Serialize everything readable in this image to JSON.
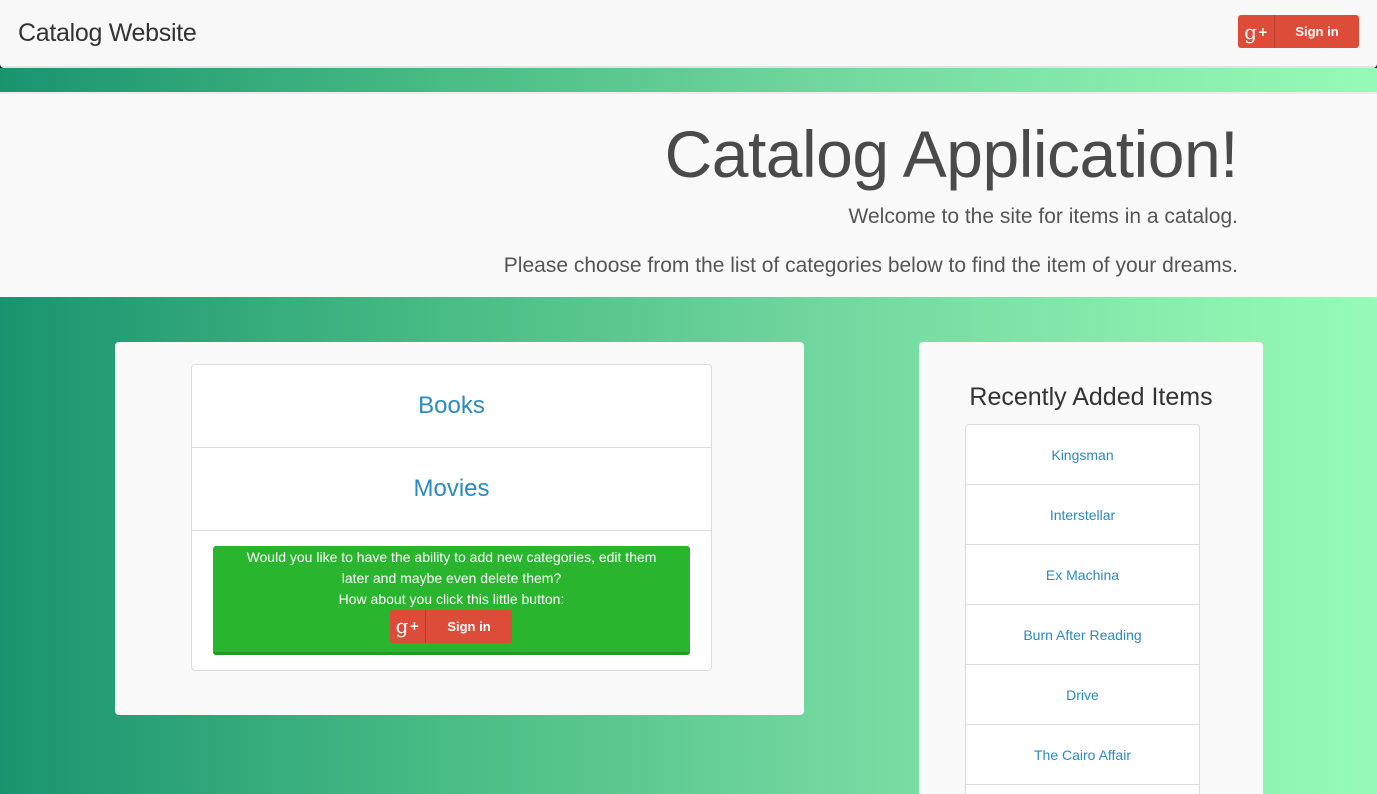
{
  "navbar": {
    "brand": "Catalog Website",
    "signin_label": "Sign in"
  },
  "jumbotron": {
    "title": "Catalog Application!",
    "lead1": "Welcome to the site for items in a catalog.",
    "lead2": "Please choose from the list of categories below to find the item of your dreams."
  },
  "categories": [
    {
      "label": "Books"
    },
    {
      "label": "Movies"
    }
  ],
  "promo": {
    "line1": "Would you like to have the ability to add new categories, edit them",
    "line2": "later and maybe even delete them?",
    "line3": "How about you click this little button:",
    "signin_label": "Sign in"
  },
  "recent": {
    "title": "Recently Added Items",
    "items": [
      {
        "label": "Kingsman"
      },
      {
        "label": "Interstellar"
      },
      {
        "label": "Ex Machina"
      },
      {
        "label": "Burn After Reading"
      },
      {
        "label": "Drive"
      },
      {
        "label": "The Cairo Affair"
      }
    ]
  },
  "icons": {
    "google_plus": "google-plus-icon"
  },
  "colors": {
    "google_red": "#dd4b39",
    "promo_green": "#29b52e",
    "link_blue": "#2a8bbd"
  }
}
